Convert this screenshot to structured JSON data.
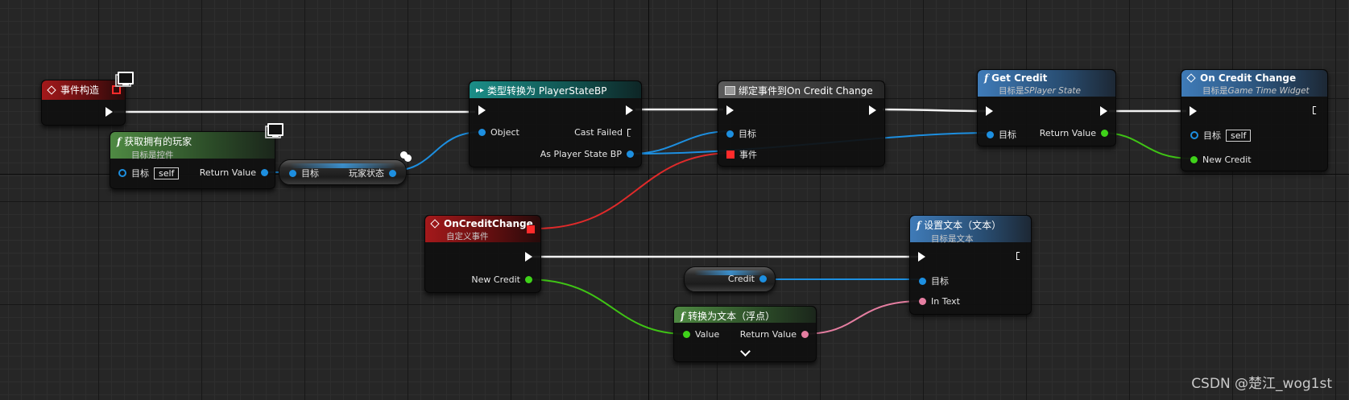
{
  "nodes": {
    "event_construct": {
      "title": "事件构造"
    },
    "get_owning_player": {
      "title": "获取拥有的玩家",
      "subtitle": "目标是控件",
      "target_label": "目标",
      "target_value": "self",
      "return_label": "Return Value"
    },
    "player_state_getter": {
      "target_label": "目标",
      "out_label": "玩家状态"
    },
    "cast": {
      "title": "类型转换为 PlayerStateBP",
      "object_label": "Object",
      "cast_failed_label": "Cast Failed",
      "as_label": "As Player State BP"
    },
    "bind_event": {
      "title": "绑定事件到On Credit Change",
      "target_label": "目标",
      "event_label": "事件"
    },
    "get_credit": {
      "title": "Get Credit",
      "subtitle_prefix": "目标是",
      "subtitle_class": "SPlayer State",
      "target_label": "目标",
      "return_label": "Return Value"
    },
    "on_credit_change_call": {
      "title": "On Credit Change",
      "subtitle_prefix": "目标是",
      "subtitle_class": "Game Time Widget",
      "target_label": "目标",
      "target_value": "self",
      "new_credit_label": "New Credit"
    },
    "custom_event": {
      "title": "OnCreditChange",
      "subtitle": "自定义事件",
      "new_credit_label": "New Credit"
    },
    "credit_getter": {
      "label": "Credit"
    },
    "set_text": {
      "title": "设置文本（文本）",
      "subtitle": "目标是文本",
      "target_label": "目标",
      "in_text_label": "In Text"
    },
    "to_text": {
      "title": "转换为文本（浮点）",
      "value_label": "Value",
      "return_label": "Return Value"
    }
  },
  "watermark": "CSDN @楚江_wog1st",
  "colors": {
    "exec": "#ffffff",
    "object_pin": "#1d8fe0",
    "float_pin": "#3fd21a",
    "text_pin": "#e57ea1",
    "delegate_pin": "#ff2b2b"
  }
}
